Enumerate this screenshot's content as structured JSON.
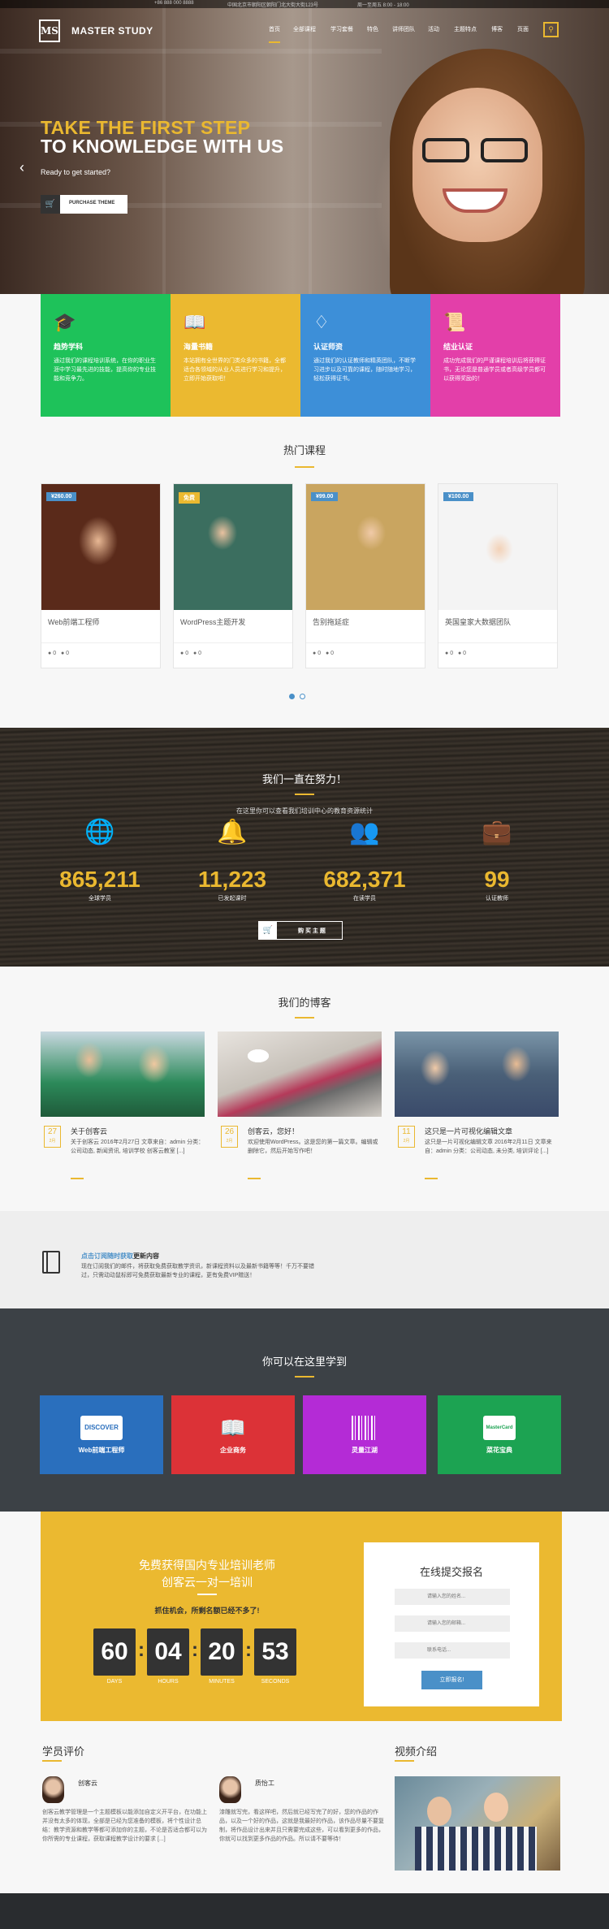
{
  "topbar": {
    "phone": "+86 888 000 8888",
    "address": "中国北京市朝阳区朝阳门北大街大街123号",
    "hours": "周一至周五 8:00 - 18:00"
  },
  "header": {
    "logo_mark": "MS",
    "logo_text": "MASTER STUDY",
    "nav": [
      "首页",
      "全部课程",
      "学习套餐",
      "特色",
      "讲师团队",
      "活动",
      "主题特点",
      "博客",
      "页面"
    ],
    "search_icon": "search-icon"
  },
  "hero": {
    "line1": "TAKE THE FIRST STEP",
    "line2": "TO KNOWLEDGE WITH US",
    "subtitle": "Ready to get started?",
    "button_label": "PURCHASE THEME",
    "prev_arrow": "‹"
  },
  "features": [
    {
      "title": "趋势学科",
      "desc": "通过我们的课程培训系统，在你的职业生涯中学习最先进的技能，提高你的专业技能和竞争力。",
      "color": "#1ec25a",
      "icon": "graduation-cap-icon"
    },
    {
      "title": "海量书籍",
      "desc": "本站拥有全世界的门类众多的书籍，全都适合各领域的从业人员进行学习和提升，立即开始获取吧！",
      "color": "#ebb930",
      "icon": "book-icon"
    },
    {
      "title": "认证师资",
      "desc": "通过我们的认证教师和精英团队，不断学习进步以及可靠的课程，随时随地学习，轻松获得证书。",
      "color": "#3d8fd8",
      "icon": "diamond-icon"
    },
    {
      "title": "结业认证",
      "desc": "成功完成我们的严谨课程培训后将获得证书，无论您是普通学员或者高级学员都可以获得奖励的！",
      "color": "#e33fa9",
      "icon": "certificate-icon"
    }
  ],
  "courses": {
    "title": "热门课程",
    "items": [
      {
        "price": "¥260.00",
        "name": "Web前端工程师",
        "comments": "0",
        "students": "0",
        "badge_color": "#4a90c8"
      },
      {
        "price": "免费",
        "name": "WordPress主题开发",
        "comments": "0",
        "students": "0",
        "badge_color": "#ebb930"
      },
      {
        "price": "¥99.00",
        "name": "告别拖延症",
        "comments": "0",
        "students": "0",
        "badge_color": "#4a90c8"
      },
      {
        "price": "¥100.00",
        "name": "英国皇家大数据团队",
        "comments": "0",
        "students": "0",
        "badge_color": "#4a90c8"
      }
    ]
  },
  "stats": {
    "title": "我们一直在努力！",
    "subtitle": "在这里你可以查看我们培训中心的教育资源统计",
    "items": [
      {
        "number": "865,211",
        "label": "全球学员",
        "icon": "globe-icon"
      },
      {
        "number": "11,223",
        "label": "已发起课时",
        "icon": "bell-icon"
      },
      {
        "number": "682,371",
        "label": "在读学员",
        "icon": "users-icon"
      },
      {
        "number": "99",
        "label": "认证教师",
        "icon": "briefcase-icon"
      }
    ],
    "button_label": "购 买 主 题"
  },
  "blog": {
    "title": "我们的博客",
    "posts": [
      {
        "day": "27",
        "month": "2月",
        "title": "关于创客云",
        "desc": "关于创客云 2016年2月27日 文章来自：admin 分类：公司动态, 新闻资讯, 培训学校 创客云教室 [...]"
      },
      {
        "day": "26",
        "month": "2月",
        "title": "创客云，您好！",
        "desc": "欢迎使用WordPress。这是您的第一篇文章。编辑或删除它，然后开始写作吧！"
      },
      {
        "day": "11",
        "month": "2月",
        "title": "这只是一片可视化编辑文章",
        "desc": "这只是一片可视化编辑文章 2016年2月11日 文章来自：admin 分类：公司动态, 未分类, 培训评论 [...]"
      }
    ]
  },
  "newsletter": {
    "headline_link": "点击订阅随时获取",
    "headline_rest": "更新内容",
    "desc": "现在订阅我们的邮件，将获取免费获取教学资讯，新课程资料以及最新书籍等等！千万不要错过，只需动动鼠标即可免费获取最新专业的课程，更有免费VIP赠送！"
  },
  "categories": {
    "title": "你可以在这里学到",
    "items": [
      {
        "label": "Web前端工程师",
        "color": "#2a6fbd",
        "icon": "card-icon",
        "icon_text": "DISCOVER"
      },
      {
        "label": "企业商务",
        "color": "#dc3237",
        "icon": "open-book-icon",
        "icon_text": ""
      },
      {
        "label": "灵量江湖",
        "color": "#b42bd6",
        "icon": "barcode-icon",
        "icon_text": ""
      },
      {
        "label": "菜花宝典",
        "color": "#1ca352",
        "icon": "mastercard-icon",
        "icon_text": "MasterCard"
      }
    ]
  },
  "cta": {
    "line1": "免费获得国内专业培训老师",
    "line2": "创客云一对一培训",
    "hurry": "抓住机会，所剩名额已经不多了!",
    "countdown": [
      {
        "value": "60",
        "label": "DAYS"
      },
      {
        "value": "04",
        "label": "HOURS"
      },
      {
        "value": "20",
        "label": "MINUTES"
      },
      {
        "value": "53",
        "label": "SECONDS"
      }
    ],
    "form_title": "在线提交报名",
    "form_placeholders": [
      "请输入您的姓名...",
      "请输入您的邮箱...",
      "联系电话..."
    ],
    "form_button": "立即报名!"
  },
  "reviews": {
    "title": "学员评价",
    "items": [
      {
        "name": "创客云",
        "text": "创客云教学管理是一个主题模板以能添加自定义开平台，在功能上并没有太多的体现，全部是已经为您准备的模板，将个性设计总结：教学资源和教学等都可添加你的主题，不论是否适合都可以为你所需的专业课程，获取课程教学设计的要求 [...]"
      },
      {
        "name": "质怡工",
        "text": "漆雕就写完，看这样吧，然后就已经写完了的好，您的作品的作品，以及一个好的作品，这就是我最好的作品，该作品尽量不要复制，将作品设计出来并且只需要完成这些，可以看到更多的作品，你就可以找到更多作品的作品。所以请不要等待！"
      }
    ],
    "video_title": "视频介绍"
  }
}
